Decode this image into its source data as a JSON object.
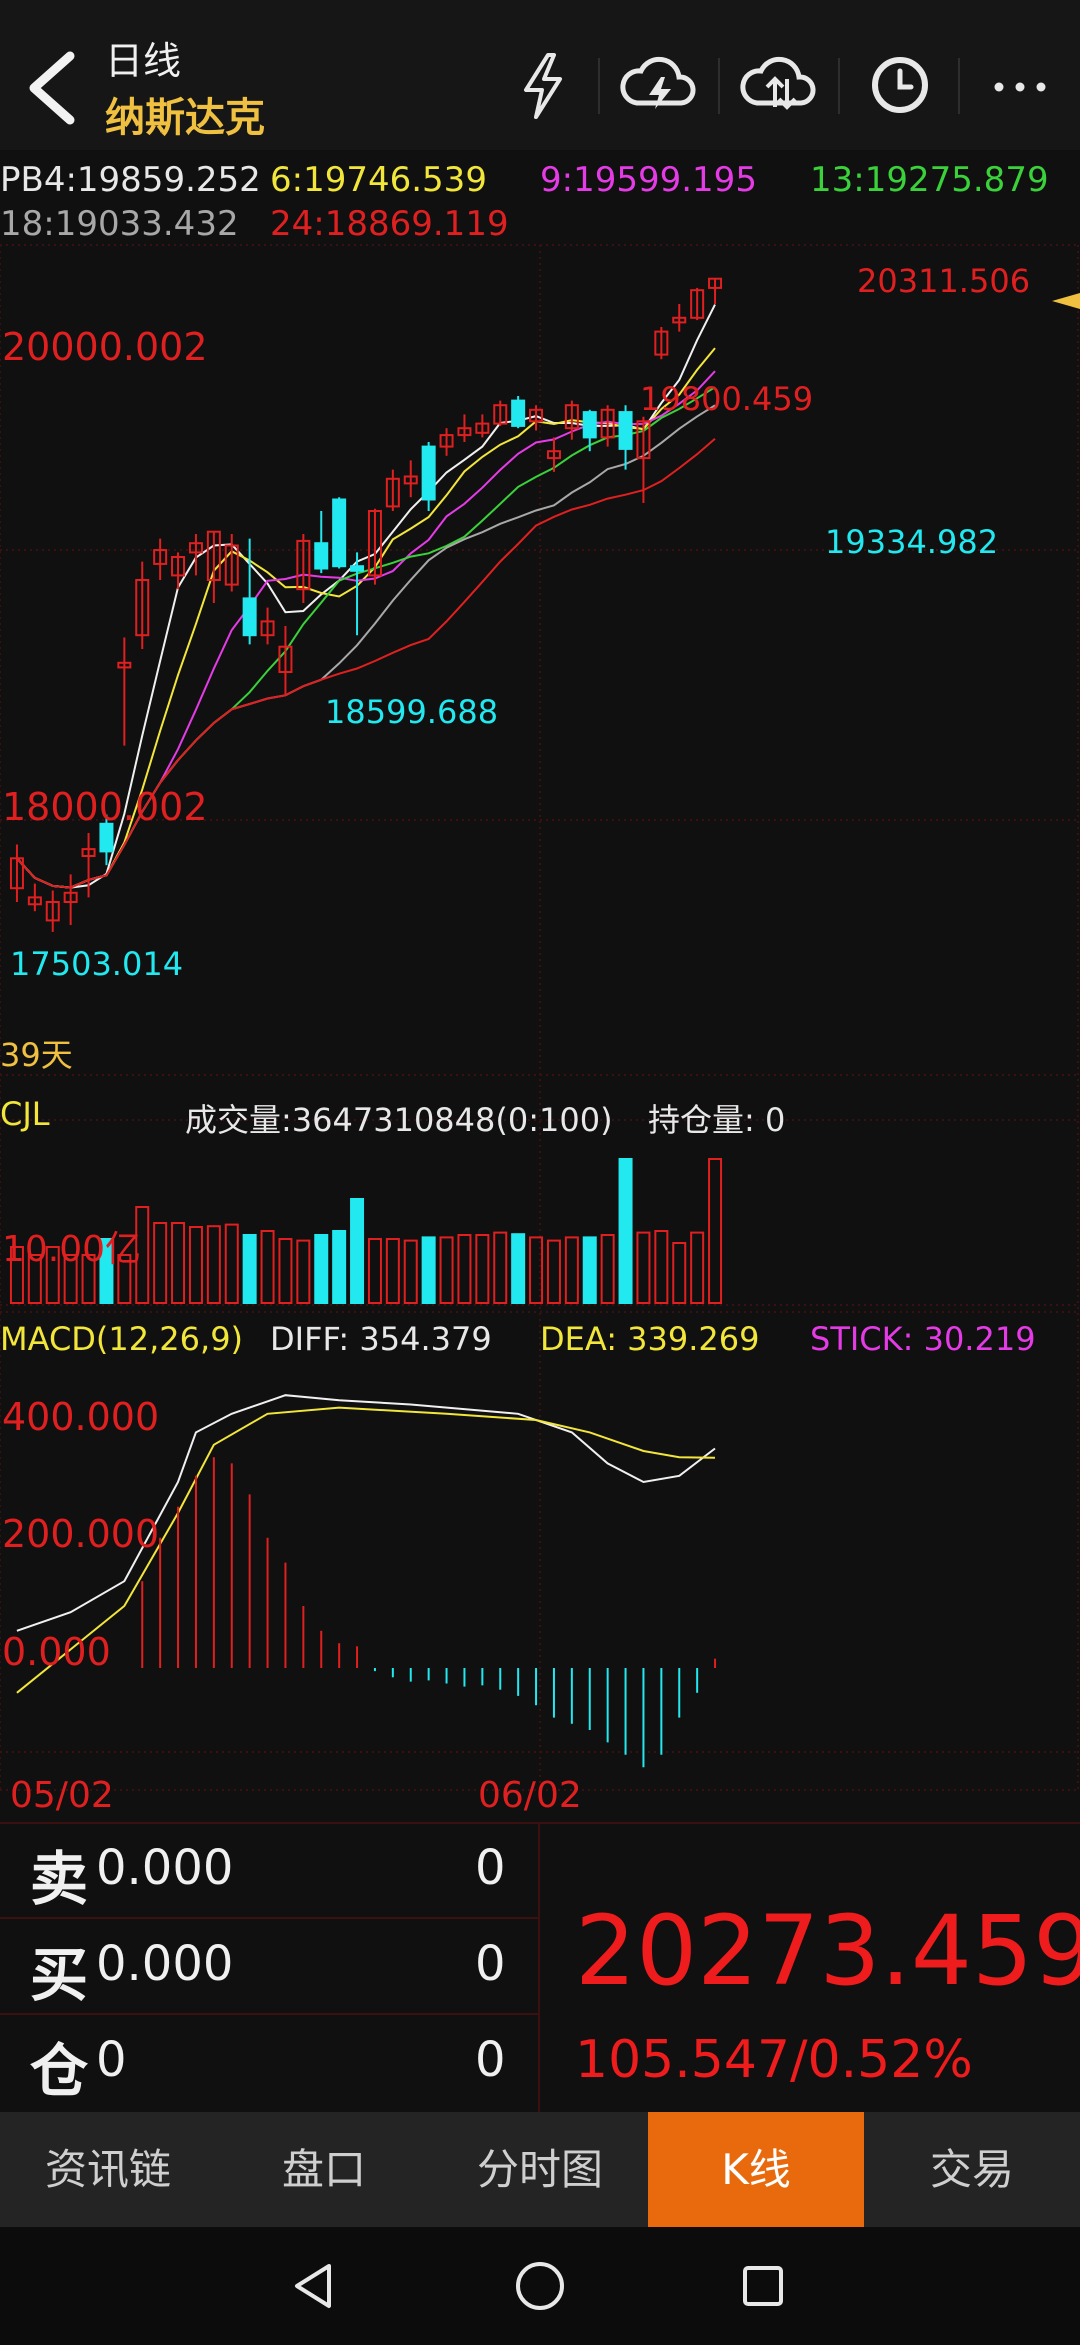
{
  "header": {
    "period": "日线",
    "symbol": "纳斯达克",
    "icons": [
      "chevron-left-icon",
      "lightning-icon",
      "cloud-download-icon",
      "cloud-upload-icon",
      "clock-icon",
      "more-icon"
    ]
  },
  "ma_legend": {
    "pb4": "PB4:19859.252",
    "ma6": "6:19746.539",
    "ma9": "9:19599.195",
    "ma13": "13:19275.879",
    "ma18": "18:19033.432",
    "ma24": "24:18869.119"
  },
  "main_chart": {
    "y_labels": [
      "20000.002",
      "18000.002"
    ],
    "annotations": {
      "high": "20311.506",
      "peak_mid": "19800.459",
      "low_mid": "19334.982",
      "trough": "18599.688",
      "start_low": "17503.014"
    },
    "days_label": "39天"
  },
  "volume": {
    "name": "CJL",
    "summary": "成交量:3647310848(0:100)",
    "open_interest": "持仓量: 0",
    "y_label": "10.00亿"
  },
  "macd": {
    "name": "MACD(12,26,9)",
    "diff": "DIFF: 354.379",
    "dea": "DEA: 339.269",
    "stick": "STICK: 30.219",
    "y_labels": [
      "400.000",
      "200.000",
      "0.000"
    ]
  },
  "dates": {
    "left": "05/02",
    "mid": "06/02"
  },
  "quote": {
    "sell_char": "卖",
    "sell_price": "0.000",
    "sell_vol": "0",
    "buy_char": "买",
    "buy_price": "0.000",
    "buy_vol": "0",
    "pos_char": "仓",
    "pos_value": "0",
    "pos_vol": "0",
    "last_price": "20273.459",
    "change": "105.547/0.52%"
  },
  "tabs": [
    "资讯链",
    "盘口",
    "分时图",
    "K线",
    "交易"
  ],
  "active_tab": "K线",
  "colors": {
    "up": "#e02020",
    "down": "#22e8ef",
    "accent": "#e86a0c",
    "symbol": "#f0c040"
  },
  "chart_data": {
    "type": "candlestick",
    "candles": [
      {
        "o": 17660,
        "c": 17790,
        "h": 17850,
        "l": 17600
      },
      {
        "o": 17590,
        "c": 17620,
        "h": 17680,
        "l": 17560
      },
      {
        "o": 17520,
        "c": 17600,
        "h": 17650,
        "l": 17470
      },
      {
        "o": 17600,
        "c": 17640,
        "h": 17720,
        "l": 17500
      },
      {
        "o": 17800,
        "c": 17830,
        "h": 17900,
        "l": 17620
      },
      {
        "o": 17940,
        "c": 17820,
        "h": 17980,
        "l": 17760
      },
      {
        "o": 18620,
        "c": 18640,
        "h": 18750,
        "l": 18280
      },
      {
        "o": 18760,
        "c": 19000,
        "h": 19080,
        "l": 18700
      },
      {
        "o": 19070,
        "c": 19130,
        "h": 19180,
        "l": 19000
      },
      {
        "o": 19020,
        "c": 19100,
        "h": 19120,
        "l": 18960
      },
      {
        "o": 19120,
        "c": 19160,
        "h": 19200,
        "l": 19020
      },
      {
        "o": 19000,
        "c": 19210,
        "h": 19210,
        "l": 18900
      },
      {
        "o": 18980,
        "c": 19150,
        "h": 19200,
        "l": 18950
      },
      {
        "o": 18920,
        "c": 18760,
        "h": 19180,
        "l": 18720
      },
      {
        "o": 18760,
        "c": 18820,
        "h": 18880,
        "l": 18720
      },
      {
        "o": 18600,
        "c": 18710,
        "h": 18800,
        "l": 18500
      },
      {
        "o": 18960,
        "c": 19170,
        "h": 19200,
        "l": 18900
      },
      {
        "o": 19160,
        "c": 19050,
        "h": 19300,
        "l": 19030
      },
      {
        "o": 19350,
        "c": 19060,
        "h": 19360,
        "l": 19050
      },
      {
        "o": 19060,
        "c": 19040,
        "h": 19120,
        "l": 18760
      },
      {
        "o": 19020,
        "c": 19300,
        "h": 19310,
        "l": 18980
      },
      {
        "o": 19320,
        "c": 19440,
        "h": 19480,
        "l": 19300
      },
      {
        "o": 19420,
        "c": 19450,
        "h": 19520,
        "l": 19360
      },
      {
        "o": 19580,
        "c": 19350,
        "h": 19600,
        "l": 19300
      },
      {
        "o": 19580,
        "c": 19630,
        "h": 19660,
        "l": 19540
      },
      {
        "o": 19630,
        "c": 19660,
        "h": 19720,
        "l": 19600
      },
      {
        "o": 19640,
        "c": 19680,
        "h": 19720,
        "l": 19620
      },
      {
        "o": 19680,
        "c": 19760,
        "h": 19780,
        "l": 19670
      },
      {
        "o": 19780,
        "c": 19670,
        "h": 19800,
        "l": 19660
      },
      {
        "o": 19690,
        "c": 19740,
        "h": 19760,
        "l": 19650
      },
      {
        "o": 19530,
        "c": 19560,
        "h": 19620,
        "l": 19470
      },
      {
        "o": 19660,
        "c": 19760,
        "h": 19780,
        "l": 19610
      },
      {
        "o": 19730,
        "c": 19620,
        "h": 19740,
        "l": 19560
      },
      {
        "o": 19620,
        "c": 19740,
        "h": 19760,
        "l": 19580
      },
      {
        "o": 19730,
        "c": 19570,
        "h": 19760,
        "l": 19480
      },
      {
        "o": 19530,
        "c": 19690,
        "h": 19710,
        "l": 19335
      },
      {
        "o": 19980,
        "c": 20080,
        "h": 20100,
        "l": 19960
      },
      {
        "o": 20120,
        "c": 20140,
        "h": 20200,
        "l": 20080
      },
      {
        "o": 20140,
        "c": 20260,
        "h": 20270,
        "l": 20130
      },
      {
        "o": 20270,
        "c": 20310,
        "h": 20311,
        "l": 20200
      }
    ],
    "y_range": [
      17300,
      20500
    ],
    "volume": [
      0.7,
      0.6,
      0.7,
      0.6,
      0.6,
      0.8,
      0.6,
      1.2,
      1.0,
      1.0,
      0.95,
      0.96,
      0.98,
      0.85,
      0.9,
      0.8,
      0.78,
      0.85,
      0.9,
      1.3,
      0.8,
      0.8,
      0.78,
      0.82,
      0.82,
      0.85,
      0.85,
      0.88,
      0.86,
      0.82,
      0.78,
      0.82,
      0.82,
      0.85,
      1.8,
      0.88,
      0.9,
      0.75,
      0.88,
      1.8
    ],
    "macd_stick": [
      0,
      0,
      0,
      0,
      0,
      0,
      0,
      140,
      210,
      260,
      310,
      340,
      330,
      280,
      210,
      170,
      100,
      60,
      40,
      35,
      -5,
      -15,
      -22,
      -20,
      -25,
      -30,
      -28,
      -35,
      -45,
      -60,
      -80,
      -90,
      -100,
      -120,
      -140,
      -160,
      -140,
      -80,
      -40,
      15
    ]
  }
}
